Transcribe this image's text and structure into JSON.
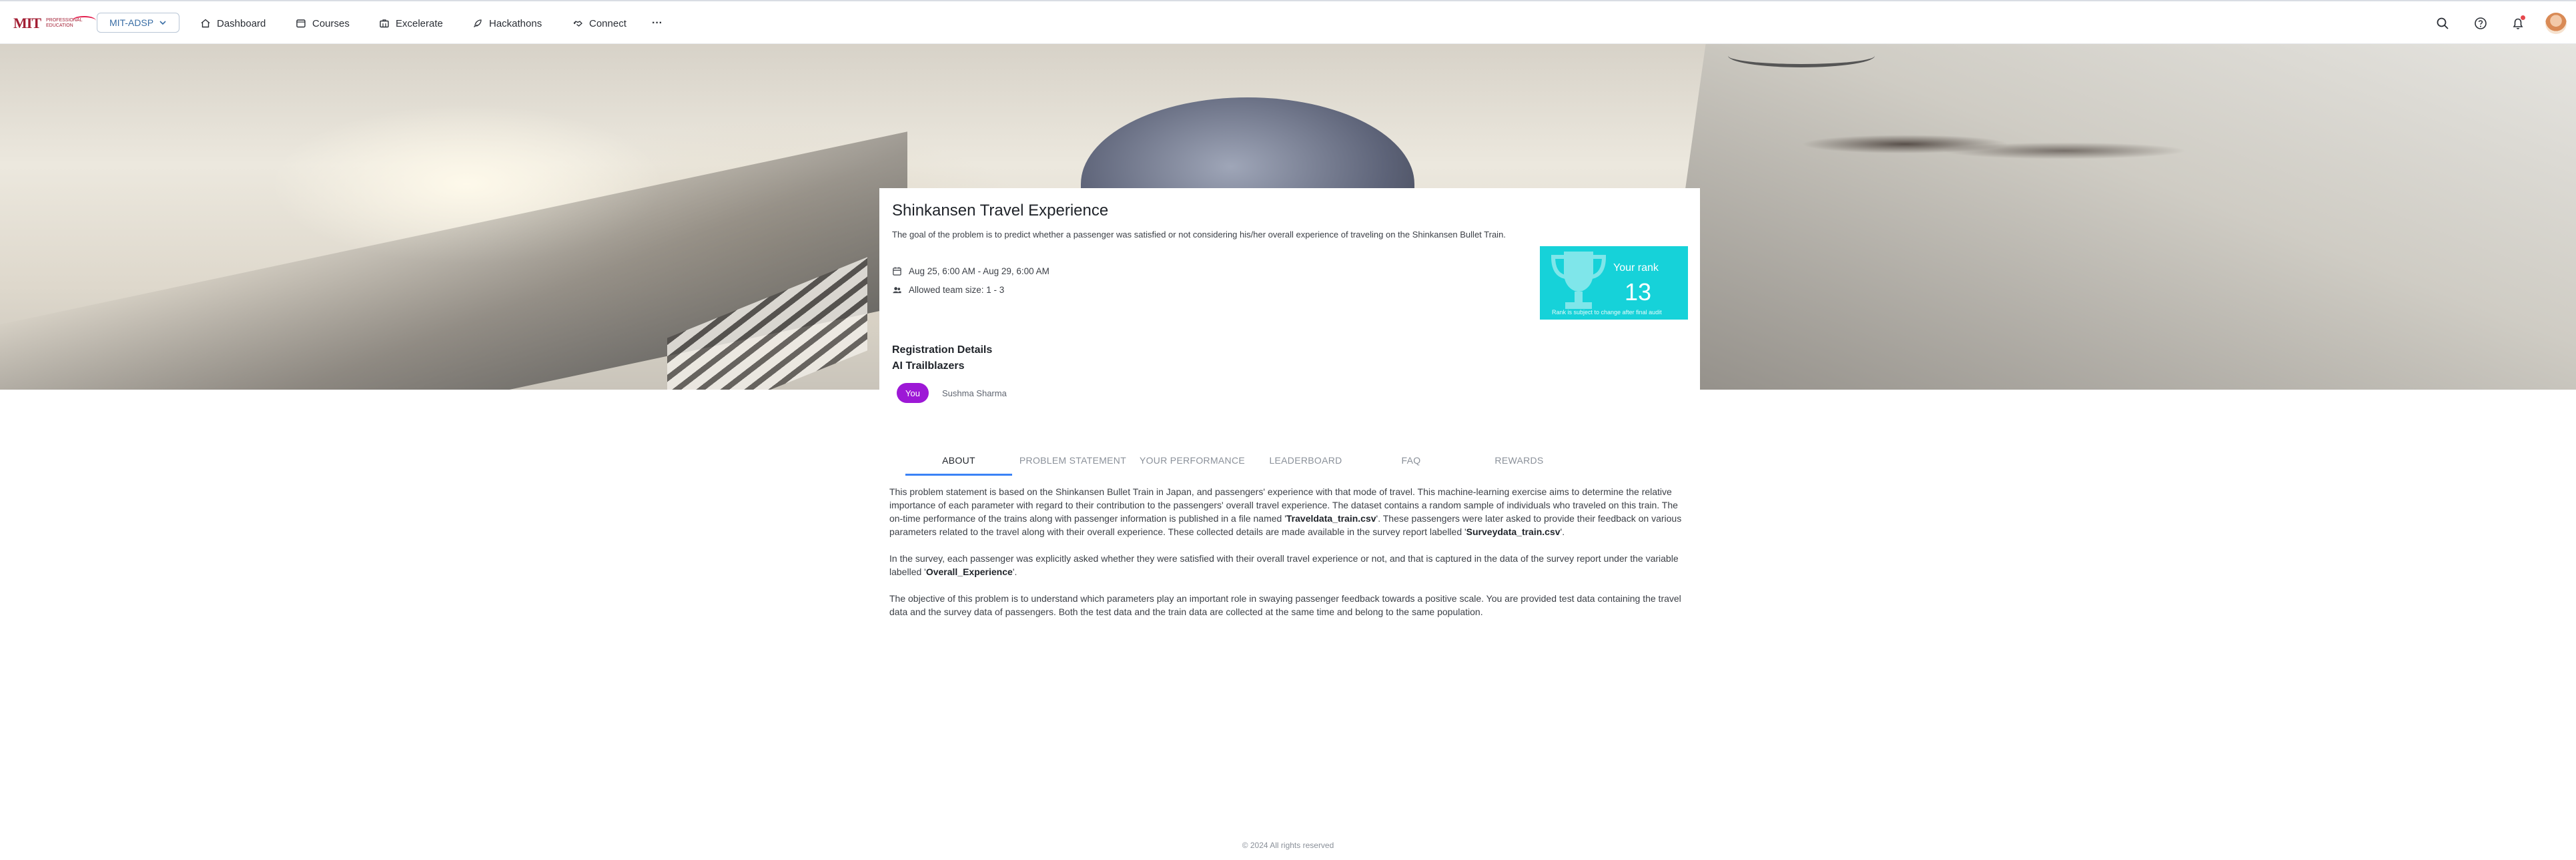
{
  "nav": {
    "logo": {
      "mark": "MIT",
      "line1": "PROFESSIONAL",
      "line2": "EDUCATION"
    },
    "program_select": "MIT-ADSP",
    "items": [
      {
        "label": "Dashboard",
        "icon": "home-icon"
      },
      {
        "label": "Courses",
        "icon": "folder-icon"
      },
      {
        "label": "Excelerate",
        "icon": "briefcase-icon"
      },
      {
        "label": "Hackathons",
        "icon": "rocket-icon"
      },
      {
        "label": "Connect",
        "icon": "handshake-icon"
      }
    ],
    "more": "···"
  },
  "hackathon": {
    "title": "Shinkansen Travel Experience",
    "description": "The goal of the problem is to predict whether a passenger was satisfied or not considering his/her overall experience of traveling on the Shinkansen Bullet Train.",
    "dates": "Aug 25, 6:00 AM - Aug 29, 6:00 AM",
    "team_size": "Allowed team size: 1 - 3",
    "rank": {
      "label": "Your rank",
      "value": "13",
      "note": "Rank is subject to change after final audit"
    },
    "registration_heading": "Registration Details",
    "team_name": "AI Trailblazers",
    "you_badge": "You",
    "member": "Sushma Sharma"
  },
  "tabs": [
    "ABOUT",
    "PROBLEM STATEMENT",
    "YOUR PERFORMANCE",
    "LEADERBOARD",
    "FAQ",
    "REWARDS"
  ],
  "active_tab": "ABOUT",
  "about": {
    "p1_a": "This problem statement is based on the Shinkansen Bullet Train in Japan, and passengers' experience with that mode of travel. This machine-learning exercise aims to determine the relative importance of each parameter with regard to their contribution to the passengers' overall travel experience. The dataset contains a random sample of individuals who traveled on this train. The on-time performance of the trains along with passenger information is published in a file named '",
    "p1_file1": "Traveldata_train.csv",
    "p1_b": "'.  These passengers were later asked to provide their feedback on various parameters related to the travel along with their overall experience. These collected details are made available in the survey report labelled '",
    "p1_file2": "Surveydata_train.csv",
    "p1_c": "'.",
    "p2_a": "In the survey, each passenger was explicitly asked whether they were satisfied with their overall travel experience or not, and that is captured in the data of the survey report under the variable labelled '",
    "p2_var": "Overall_Experience",
    "p2_b": "'.",
    "p3": "The objective of this problem is to understand which parameters play an important role in swaying passenger feedback towards a positive scale. You are provided test data containing the travel data and the survey data of passengers. Both the test data and the train data are collected at the same time and belong to the same population."
  },
  "footer": "© 2024 All rights reserved",
  "colors": {
    "accent": "#3b82f6",
    "rank_bg": "#16d2d9",
    "you_badge": "#9d18d6",
    "brand": "#a31f34"
  }
}
